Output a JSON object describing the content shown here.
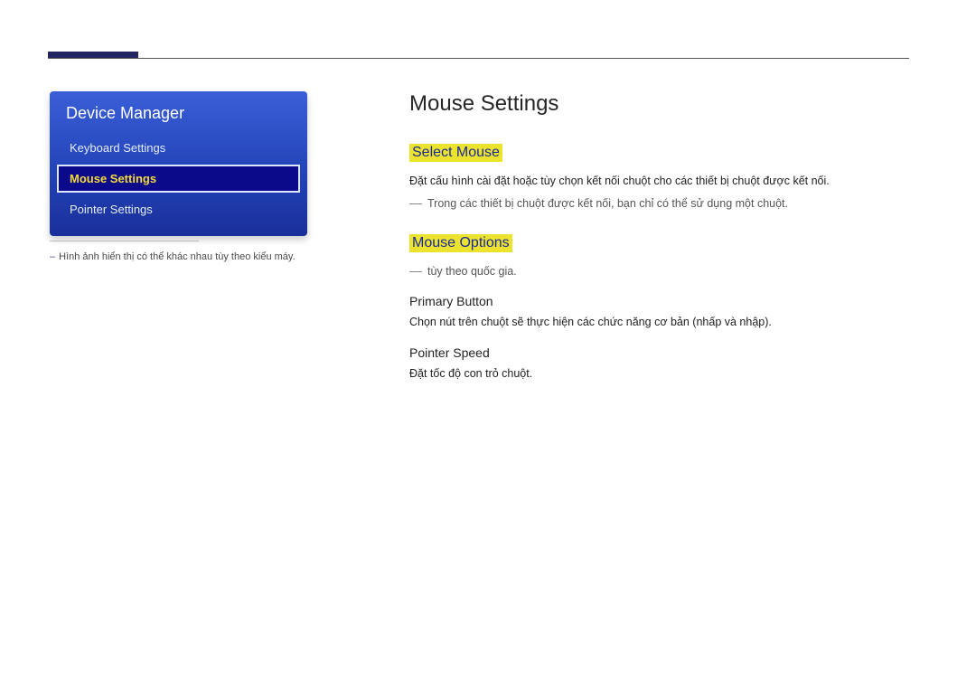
{
  "sidebar": {
    "title": "Device Manager",
    "items": [
      {
        "label": "Keyboard Settings"
      },
      {
        "label": "Mouse Settings"
      },
      {
        "label": "Pointer Settings"
      }
    ],
    "note": "Hình ảnh hiển thị có thể khác nhau tùy theo kiểu máy."
  },
  "main": {
    "title": "Mouse Settings",
    "select_mouse": {
      "header": "Select Mouse",
      "p1": "Đặt cấu hình cài đặt hoặc tùy chọn kết nối chuột cho các thiết bị chuột được kết nối.",
      "p2": "Trong các thiết bị chuột được kết nối, bạn chỉ có thể sử dụng một chuột."
    },
    "mouse_options": {
      "header": "Mouse Options",
      "note": "tùy theo quốc gia.",
      "primary_button": {
        "title": "Primary Button",
        "desc": "Chọn nút trên chuột sẽ thực hiện các chức năng cơ bản (nhấp và nhập)."
      },
      "pointer_speed": {
        "title": "Pointer Speed",
        "desc": "Đặt tốc độ con trỏ chuột."
      }
    }
  }
}
